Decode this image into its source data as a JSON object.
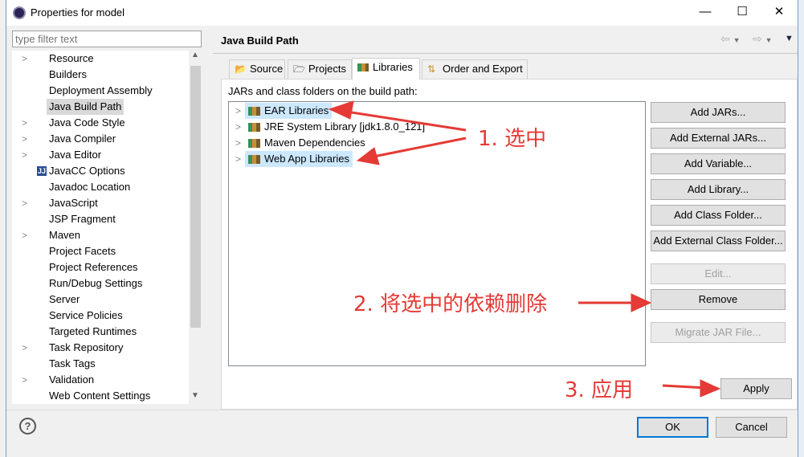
{
  "window": {
    "title": "Properties for model",
    "minimize": "—",
    "maximize": "☐",
    "close": "✕"
  },
  "filter": {
    "placeholder": "type filter text"
  },
  "tree": [
    {
      "label": "Resource",
      "expandable": true
    },
    {
      "label": "Builders",
      "expandable": false
    },
    {
      "label": "Deployment Assembly",
      "expandable": false
    },
    {
      "label": "Java Build Path",
      "expandable": false,
      "selected": true
    },
    {
      "label": "Java Code Style",
      "expandable": true
    },
    {
      "label": "Java Compiler",
      "expandable": true
    },
    {
      "label": "Java Editor",
      "expandable": true
    },
    {
      "label": "JavaCC Options",
      "expandable": false,
      "icon": "javacc-icon"
    },
    {
      "label": "Javadoc Location",
      "expandable": false
    },
    {
      "label": "JavaScript",
      "expandable": true
    },
    {
      "label": "JSP Fragment",
      "expandable": false
    },
    {
      "label": "Maven",
      "expandable": true
    },
    {
      "label": "Project Facets",
      "expandable": false
    },
    {
      "label": "Project References",
      "expandable": false
    },
    {
      "label": "Run/Debug Settings",
      "expandable": false
    },
    {
      "label": "Server",
      "expandable": false
    },
    {
      "label": "Service Policies",
      "expandable": false
    },
    {
      "label": "Targeted Runtimes",
      "expandable": false
    },
    {
      "label": "Task Repository",
      "expandable": true
    },
    {
      "label": "Task Tags",
      "expandable": false
    },
    {
      "label": "Validation",
      "expandable": true
    },
    {
      "label": "Web Content Settings",
      "expandable": false
    }
  ],
  "page": {
    "title": "Java Build Path"
  },
  "tabs": [
    {
      "label": "Source",
      "icon": "source-folder-icon"
    },
    {
      "label": "Projects",
      "icon": "projects-folder-icon"
    },
    {
      "label": "Libraries",
      "icon": "library-icon",
      "active": true
    },
    {
      "label": "Order and Export",
      "icon": "order-export-icon"
    }
  ],
  "build_path_label": "JARs and class folders on the build path:",
  "libraries": [
    {
      "label": "EAR Libraries",
      "selected": true
    },
    {
      "label": "JRE System Library [jdk1.8.0_121]",
      "selected": false
    },
    {
      "label": "Maven Dependencies",
      "selected": false
    },
    {
      "label": "Web App Libraries",
      "selected": true
    }
  ],
  "buttons": {
    "add_jars": "Add JARs...",
    "add_external_jars": "Add External JARs...",
    "add_variable": "Add Variable...",
    "add_library": "Add Library...",
    "add_class_folder": "Add Class Folder...",
    "add_external_class_folder": "Add External Class Folder...",
    "edit": "Edit...",
    "remove": "Remove",
    "migrate": "Migrate JAR File...",
    "apply": "Apply",
    "ok": "OK",
    "cancel": "Cancel"
  },
  "annotations": {
    "step1": "1. 选中",
    "step2": "2. 将选中的依赖删除",
    "step3": "3. 应用",
    "color": "#e53a35"
  }
}
